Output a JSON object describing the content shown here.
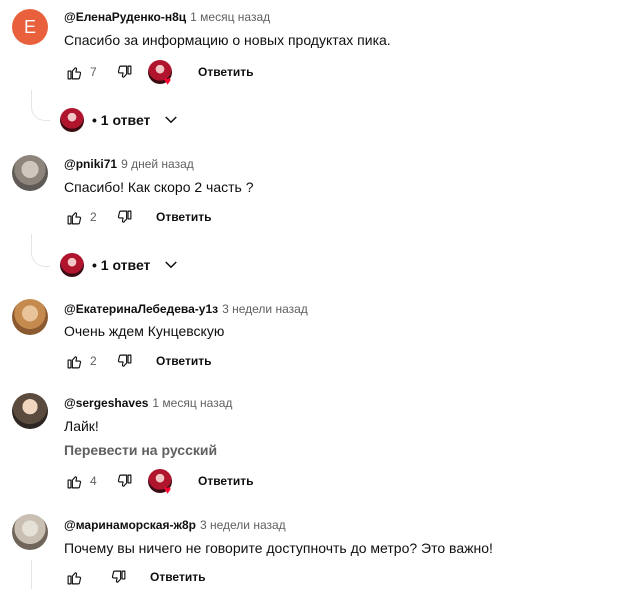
{
  "comments": [
    {
      "avatar_letter": "E",
      "author": "@ЕленаРуденко-н8ц",
      "time": "1 месяц назад",
      "text": "Спасибо за информацию о новых продуктах пика.",
      "likes": "7",
      "reply_label": "Ответить",
      "replies_label": "• 1 ответ"
    },
    {
      "author": "@pniki71",
      "time": "9 дней назад",
      "text": "Спасибо! Как скоро 2 часть ?",
      "likes": "2",
      "reply_label": "Ответить",
      "replies_label": "• 1 ответ"
    },
    {
      "author": "@ЕкатеринаЛебедева-у1з",
      "time": "3 недели назад",
      "text": "Очень ждем Кунцевскую",
      "likes": "2",
      "reply_label": "Ответить"
    },
    {
      "author": "@sergeshaves",
      "time": "1 месяц назад",
      "text": "Лайк!",
      "translate": "Перевести на русский",
      "likes": "4",
      "reply_label": "Ответить"
    },
    {
      "author": "@маринаморская-ж8р",
      "time": "3 недели назад",
      "text": "Почему вы ничего не говорите доступночть до метро? Это важно!",
      "likes": "",
      "reply_label": "Ответить"
    }
  ],
  "colors": {
    "letter_avatar": "#e8613c",
    "heart": "#ff0033",
    "muted": "#606060"
  },
  "icons": [
    "thumb-up-icon",
    "thumb-down-icon",
    "chevron-down-icon",
    "creator-heart-icon"
  ]
}
